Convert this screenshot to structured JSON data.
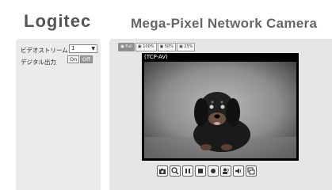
{
  "header": {
    "logo": "Logitec",
    "title": "Mega-Pixel Network Camera"
  },
  "sidebar": {
    "video_stream_label": "ビデオストリーム",
    "video_stream_value": "1",
    "digital_output_label": "デジタル出力",
    "on_label": "On",
    "off_label": "Off"
  },
  "viewer": {
    "size_buttons": [
      "Full",
      "100%",
      "50%",
      "25%"
    ],
    "video_label": "(TCP-AV)"
  },
  "controls": [
    "snapshot-icon",
    "zoom-icon",
    "pause-icon",
    "stop-icon",
    "record-icon",
    "talk-icon",
    "volume-icon",
    "fullscreen-icon"
  ]
}
